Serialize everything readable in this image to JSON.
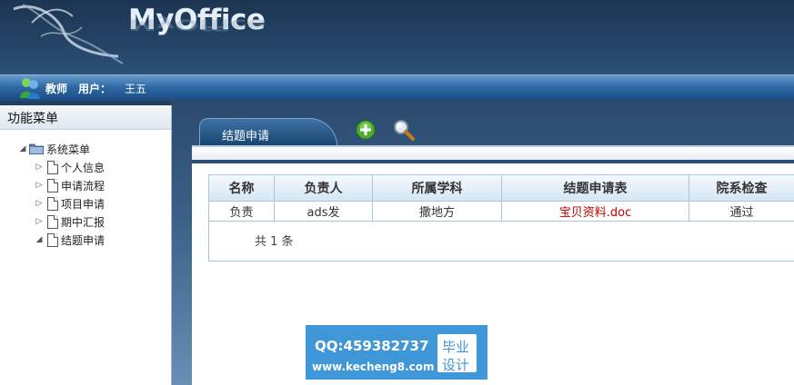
{
  "header": {
    "brand": "MyOffice",
    "logo_icon": "ribbon-logo-icon"
  },
  "userbar": {
    "role": "教师",
    "user_label": "用户：",
    "user_name": "王五",
    "avatar_icon": "messenger-user-icon"
  },
  "sidebar": {
    "title": "功能菜单",
    "root": {
      "label": "系统菜单",
      "expanded": true,
      "icon": "folder-icon"
    },
    "items": [
      {
        "label": "个人信息",
        "expanded": false,
        "icon": "document-icon"
      },
      {
        "label": "申请流程",
        "expanded": false,
        "icon": "document-icon"
      },
      {
        "label": "项目申请",
        "expanded": false,
        "icon": "document-icon"
      },
      {
        "label": "期中汇报",
        "expanded": false,
        "icon": "document-icon"
      },
      {
        "label": "结题申请",
        "expanded": true,
        "icon": "document-icon"
      }
    ]
  },
  "main": {
    "tab_label": "结题申请",
    "toolbar": {
      "add_icon": "add-icon",
      "search_icon": "search-icon"
    },
    "table": {
      "columns": [
        "名称",
        "负责人",
        "所属学科",
        "结题申请表",
        "院系检查"
      ],
      "rows": [
        [
          "负责",
          "ads发",
          "撒地方",
          "宝贝资料.doc",
          "通过"
        ]
      ],
      "total": "共 1 条"
    }
  },
  "watermark": {
    "qq": "QQ:459382737",
    "url": "www.kecheng8.com",
    "box_line1": "毕业",
    "box_line2": "设计"
  },
  "colors": {
    "header_bg": "#26476a",
    "userbar_bg": "#2f6aa6",
    "link_red": "#c00000",
    "grid_border": "#a9c6e0",
    "watermark_blue": "#3f97d8"
  }
}
